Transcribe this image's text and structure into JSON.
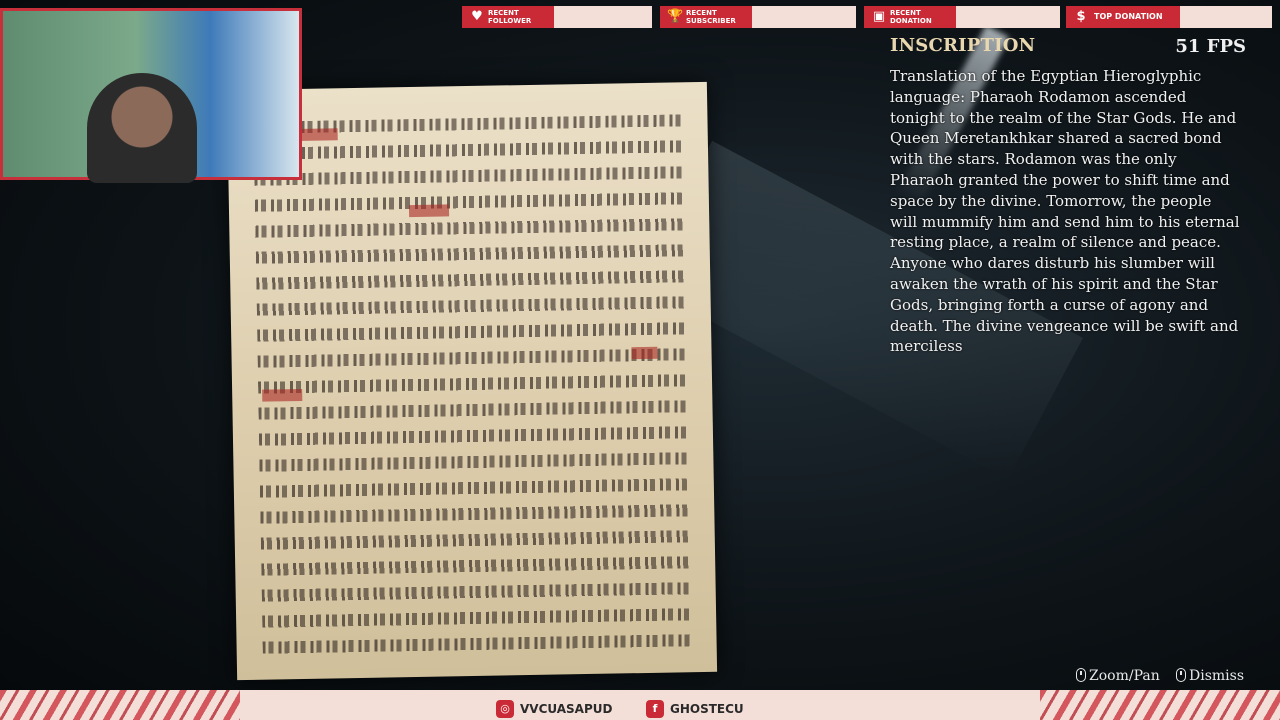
{
  "alerts": [
    {
      "label": "RECENT FOLLOWER",
      "icon": "heart-icon"
    },
    {
      "label": "RECENT SUBSCRIBER",
      "icon": "trophy-icon"
    },
    {
      "label": "RECENT DONATION",
      "icon": "cash-register-icon"
    }
  ],
  "top_donation": {
    "label": "TOP DONATION",
    "icon": "money-bag-icon"
  },
  "hud": {
    "title": "INSCRIPTION",
    "fps": "51 FPS",
    "translation": "Translation of the Egyptian Hieroglyphic language: Pharaoh Rodamon ascended tonight to the realm of the Star Gods. He and Queen Meretankhkar shared a sacred bond with the stars. Rodamon was the only Pharaoh granted the power to shift time and space by the divine. Tomorrow, the people will mummify him and send him to his eternal resting place, a realm of silence and peace. Anyone who dares disturb his slumber will awaken the wrath of his spirit and the Star Gods, bringing forth a curse of agony and death. The divine vengeance will be swift and merciless"
  },
  "controls": {
    "zoom_pan": "Zoom/Pan",
    "dismiss": "Dismiss"
  },
  "socials": {
    "instagram": "VVCUASAPUD",
    "facebook": "GHOSTECU"
  },
  "colors": {
    "accent": "#c92a35",
    "bar_bg": "#f3ded8",
    "title": "#e9d7b0"
  }
}
